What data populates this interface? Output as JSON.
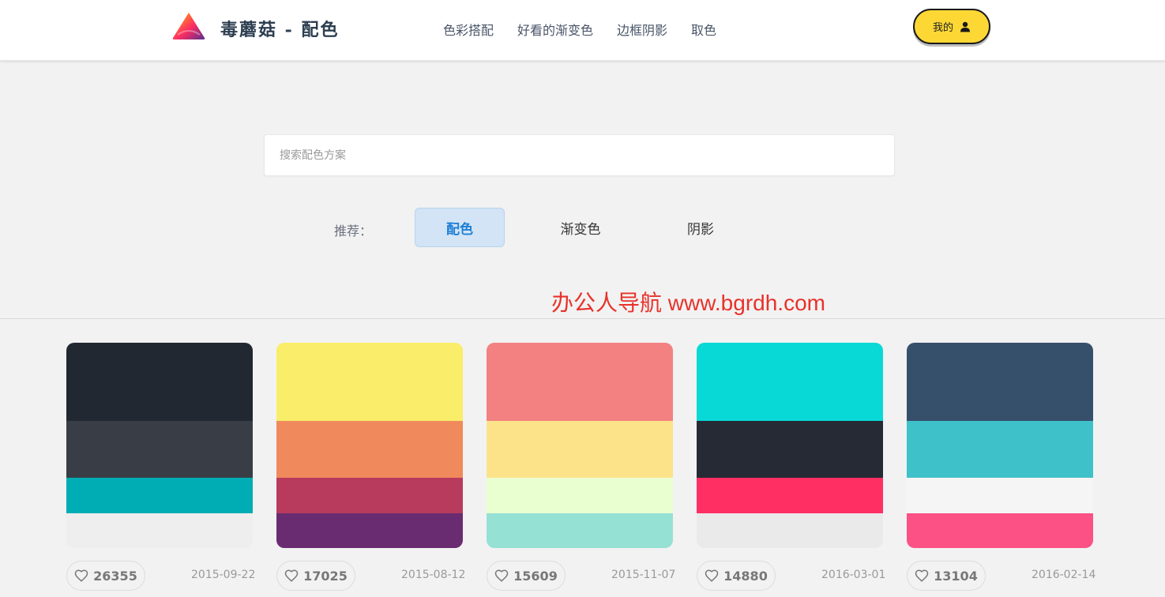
{
  "header": {
    "brand": "毒蘑菇 - 配色",
    "nav": [
      "色彩搭配",
      "好看的渐变色",
      "边框阴影",
      "取色"
    ],
    "my_label": "我的",
    "my_icon": "user-icon",
    "logo_icon": "mountain-logo-icon"
  },
  "search": {
    "placeholder": "搜索配色方案"
  },
  "recommend": {
    "label": "推荐：",
    "tabs": [
      "配色",
      "渐变色",
      "阴影"
    ],
    "active_tab": "配色"
  },
  "watermark": "办公人导航  www.bgrdh.com",
  "palettes": [
    {
      "colors": [
        "#222831",
        "#393e46",
        "#00adb5",
        "#eeeeee"
      ],
      "likes": "26355",
      "date": "2015-09-22"
    },
    {
      "colors": [
        "#f9ed69",
        "#f08a5d",
        "#b83b5e",
        "#6a2c70"
      ],
      "likes": "17025",
      "date": "2015-08-12"
    },
    {
      "colors": [
        "#f38181",
        "#fce38a",
        "#eaffd0",
        "#95e1d3"
      ],
      "likes": "15609",
      "date": "2015-11-07"
    },
    {
      "colors": [
        "#08d9d6",
        "#252a34",
        "#ff2e63",
        "#eaeaea"
      ],
      "likes": "14880",
      "date": "2016-03-01"
    },
    {
      "colors": [
        "#364f6b",
        "#3fc1c9",
        "#f5f5f5",
        "#fc5185"
      ],
      "likes": "13104",
      "date": "2016-02-14"
    }
  ]
}
